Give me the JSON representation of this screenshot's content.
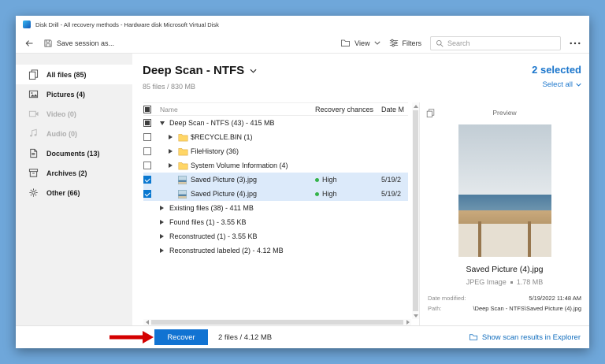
{
  "window": {
    "title": "Disk Drill - All recovery methods - Hardware disk Microsoft Virtual Disk"
  },
  "toolbar": {
    "save_session_label": "Save session as...",
    "view_label": "View",
    "filters_label": "Filters",
    "search_placeholder": "Search"
  },
  "sidebar": {
    "items": [
      {
        "label": "All files (85)",
        "icon": "all-files-icon",
        "selected": true,
        "disabled": false
      },
      {
        "label": "Pictures (4)",
        "icon": "pictures-icon",
        "selected": false,
        "disabled": false
      },
      {
        "label": "Video (0)",
        "icon": "video-icon",
        "selected": false,
        "disabled": true
      },
      {
        "label": "Audio (0)",
        "icon": "audio-icon",
        "selected": false,
        "disabled": true
      },
      {
        "label": "Documents (13)",
        "icon": "documents-icon",
        "selected": false,
        "disabled": false
      },
      {
        "label": "Archives (2)",
        "icon": "archives-icon",
        "selected": false,
        "disabled": false
      },
      {
        "label": "Other (66)",
        "icon": "other-icon",
        "selected": false,
        "disabled": false
      }
    ]
  },
  "main": {
    "title": "Deep Scan - NTFS",
    "subtitle": "85 files / 830 MB",
    "selected_count": "2 selected",
    "select_all_label": "Select all",
    "columns": {
      "name": "Name",
      "recovery": "Recovery chances",
      "date": "Date M"
    },
    "rows": [
      {
        "name": "Deep Scan - NTFS (43) - 415 MB",
        "checkbox": "indeterminate",
        "expanded": true,
        "level": 0
      },
      {
        "name": "$RECYCLE.BIN (1)",
        "checkbox": "unchecked",
        "icon": "folder-icon",
        "level": 1
      },
      {
        "name": "FileHistory (36)",
        "checkbox": "unchecked",
        "icon": "folder-icon",
        "level": 1
      },
      {
        "name": "System Volume Information (4)",
        "checkbox": "unchecked",
        "icon": "folder-icon",
        "level": 1
      },
      {
        "name": "Saved Picture (3).jpg",
        "checkbox": "checked",
        "icon": "image-file-icon",
        "recovery": "High",
        "date": "5/19/2",
        "level": 1
      },
      {
        "name": "Saved Picture (4).jpg",
        "checkbox": "checked",
        "icon": "image-file-icon",
        "recovery": "High",
        "date": "5/19/2",
        "level": 1
      },
      {
        "name": "Existing files (38) - 411 MB",
        "level": 0
      },
      {
        "name": "Found files (1) - 3.55 KB",
        "level": 0
      },
      {
        "name": "Reconstructed (1) - 3.55 KB",
        "level": 0
      },
      {
        "name": "Reconstructed labeled (2) - 4.12 MB",
        "level": 0
      }
    ]
  },
  "preview": {
    "header": "Preview",
    "filename": "Saved Picture (4).jpg",
    "filetype": "JPEG Image",
    "filesize": "1.78 MB",
    "date_modified_label": "Date modified:",
    "date_modified_value": "5/19/2022 11:48 AM",
    "path_label": "Path:",
    "path_value": "\\Deep Scan - NTFS\\Saved Picture (4).jpg"
  },
  "footer": {
    "recover_label": "Recover",
    "selection_summary": "2 files / 4.12 MB",
    "explorer_link_label": "Show scan results in Explorer"
  },
  "colors": {
    "accent_blue": "#1173d2",
    "link_blue": "#0f6cbd",
    "success_green": "#35b34a",
    "desktop_background": "#6fa7da",
    "annotation_red": "#d40000"
  }
}
